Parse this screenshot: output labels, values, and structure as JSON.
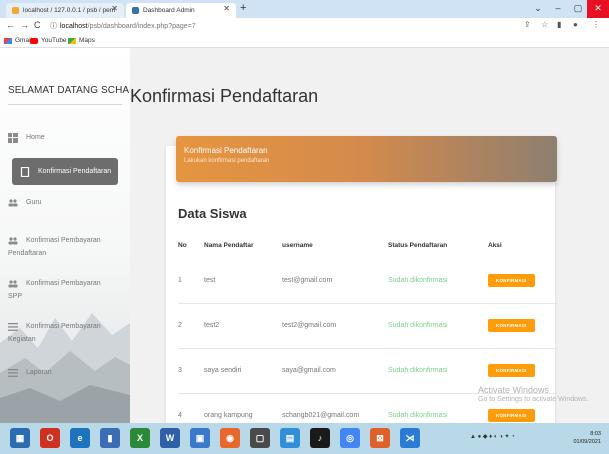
{
  "browser": {
    "tabs": [
      {
        "label": "localhost / 127.0.0.1 / psb / pem",
        "active": false
      },
      {
        "label": "Dashboard Admin",
        "active": true
      }
    ],
    "new_tab": "+",
    "url_host": "localhost",
    "url_path": "/psb/dashboard/index.php?page=7",
    "bookmarks": [
      "Gmail",
      "YouTube",
      "Maps"
    ]
  },
  "sidebar": {
    "brand": "SELAMAT DATANG SCHAN",
    "items": [
      {
        "label": "Home",
        "icon": "dashboard-icon"
      },
      {
        "label": "Konfirmasi Pendaftaran",
        "icon": "document-icon",
        "active": true
      },
      {
        "label": "Guru",
        "icon": "people-icon"
      },
      {
        "label": "Konfirmasi Pembayaran",
        "label2": "Pendaftaran",
        "icon": "people-icon"
      },
      {
        "label": "Konfirmasi Pembayaran",
        "label2": "SPP",
        "icon": "people-icon"
      },
      {
        "label": "Konfirmasi Pembayaran",
        "label2": "Kegiatan",
        "icon": "list-icon"
      },
      {
        "label": "Laporan",
        "icon": "list-icon"
      }
    ]
  },
  "main": {
    "page_title": "Konfirmasi Pendaftaran",
    "card_title": "Konfirmasi Pendaftaran",
    "card_subtitle": "Lakukan konfirmasi pendaftaran",
    "section_title": "Data Siswa",
    "table": {
      "headers": [
        "No",
        "Nama Pendaftar",
        "username",
        "Status Pendaftaran",
        "Aksi"
      ],
      "rows": [
        {
          "no": "1",
          "nama": "test",
          "username": "test@gmail.com",
          "status": "Sudah dikonfirmasi",
          "aksi": "KONFIRMASI"
        },
        {
          "no": "2",
          "nama": "test2",
          "username": "test2@gmail.com",
          "status": "Sudah dikonfirmasi",
          "aksi": "KONFIRMASI"
        },
        {
          "no": "3",
          "nama": "saya sendiri",
          "username": "saya@gmail.com",
          "status": "Sudah dikonfirmasi",
          "aksi": "KONFIRMASI"
        },
        {
          "no": "4",
          "nama": "orang kampung",
          "username": "schangb021@gmail.com",
          "status": "Sudah dikonfirmasi",
          "aksi": "KONFIRMASI"
        }
      ]
    }
  },
  "watermark": {
    "title": "Activate Windows",
    "subtitle": "Go to Settings to activate Windows."
  },
  "taskbar": {
    "time": "8:03",
    "date": "01/09/2021"
  },
  "colors": {
    "accent_orange": "#ff9c0a",
    "active_menu": "#6d6d6d",
    "status_green": "#7ccf8a",
    "header_gradient_start": "#e6953f",
    "header_gradient_end": "#8e7f6f"
  }
}
